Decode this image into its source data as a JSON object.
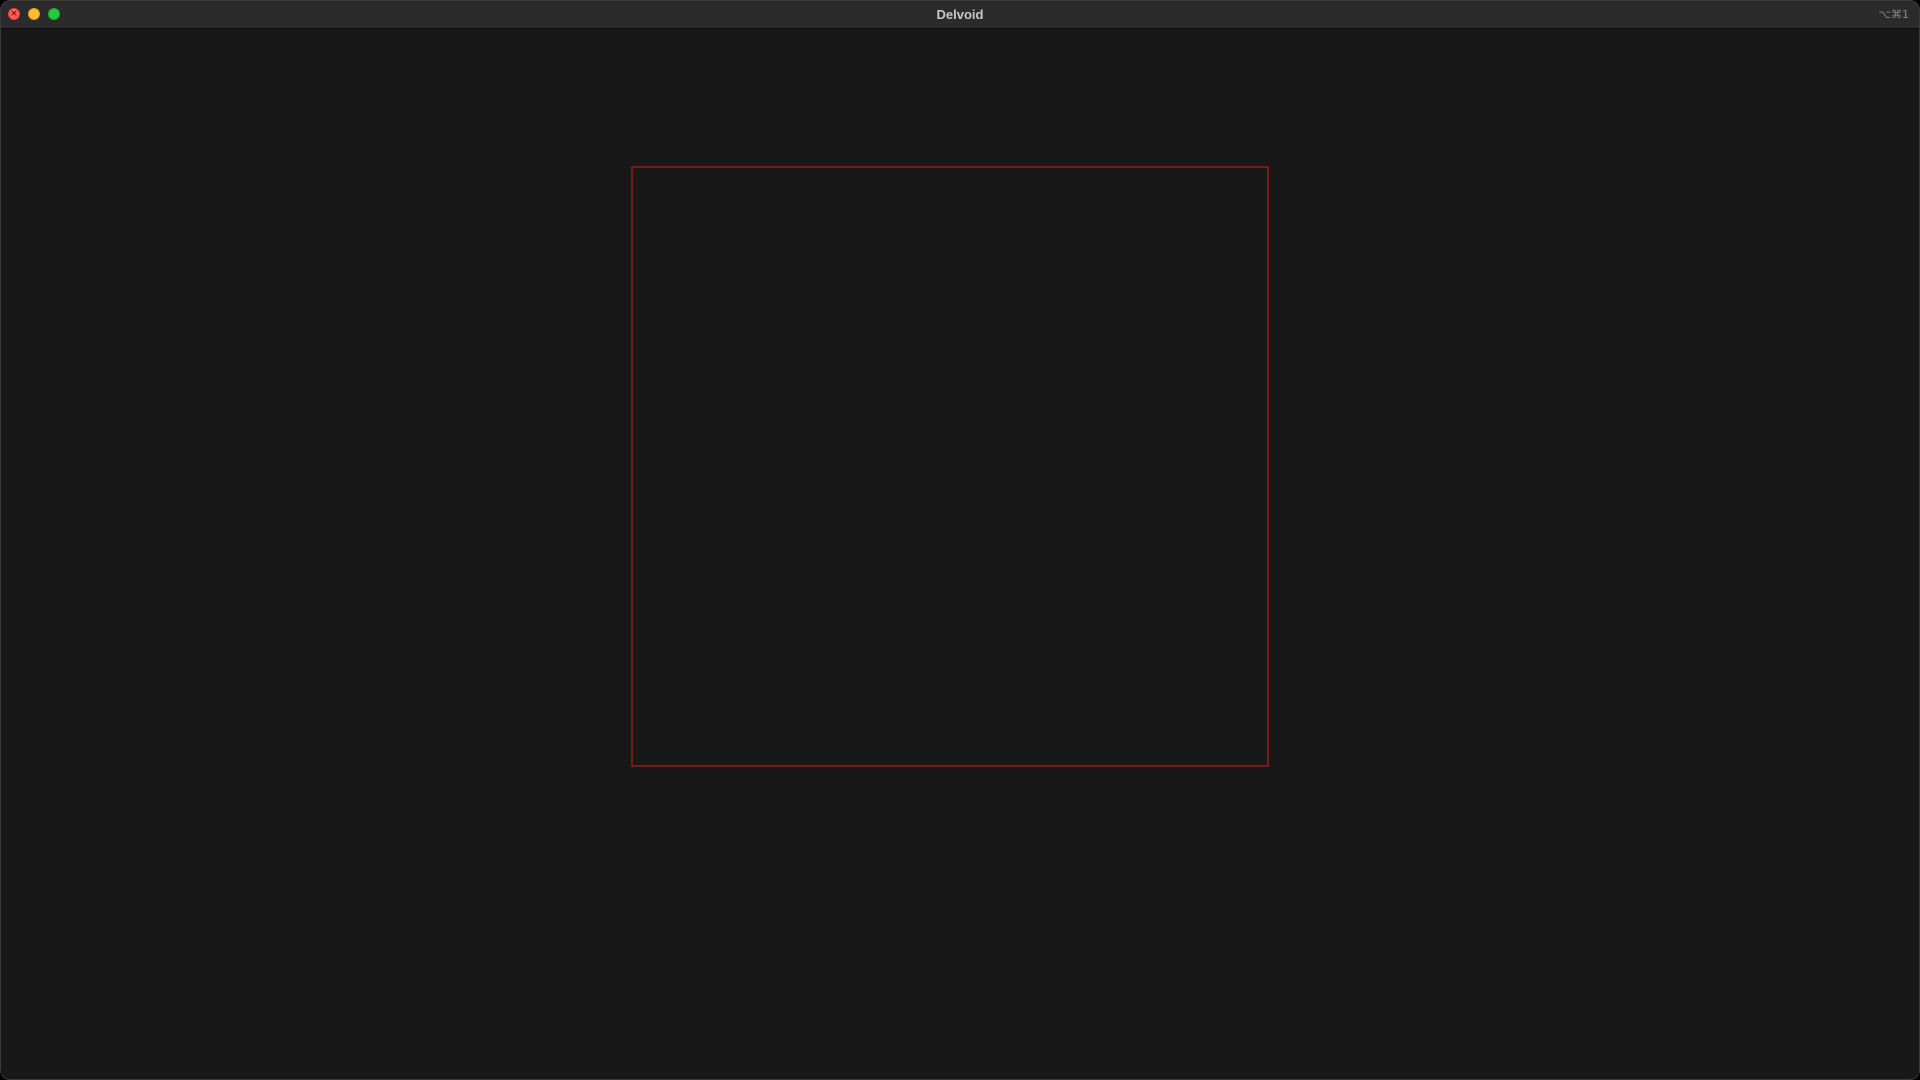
{
  "window": {
    "title": "Delvoid",
    "shortcut": "⌥⌘1"
  },
  "controls": {
    "close_glyph": "×",
    "close_icon": "close-icon",
    "minimize_icon": "minimize-icon",
    "zoom_icon": "zoom-icon"
  },
  "colors": {
    "background": "#181818",
    "titlebar": "#2b2b2b",
    "frame_border": "#7a1a14",
    "close": "#ff5f57",
    "minimize": "#febc2e",
    "zoom": "#28c840"
  }
}
